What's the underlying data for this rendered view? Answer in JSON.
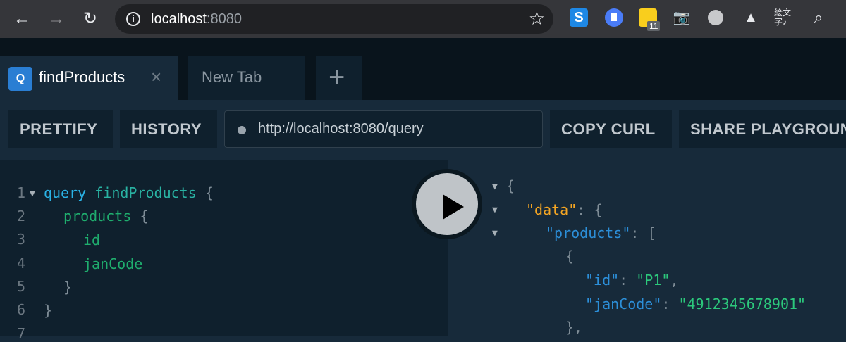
{
  "browser": {
    "url_host": "localhost",
    "url_port": ":8080",
    "extensions": [
      {
        "name": "s-extension-icon",
        "label": "S"
      },
      {
        "name": "bookmark-extension-icon"
      },
      {
        "name": "yellow-extension-icon",
        "badge": "11"
      },
      {
        "name": "camera-extension-icon"
      },
      {
        "name": "circle-extension-icon"
      },
      {
        "name": "warning-extension-icon"
      },
      {
        "name": "kanji-extension-icon",
        "label": "絵文字♪"
      },
      {
        "name": "search-extension-icon"
      }
    ]
  },
  "tabs": [
    {
      "badge": "Q",
      "title": "findProducts",
      "active": true
    },
    {
      "title": "New Tab",
      "active": false
    }
  ],
  "toolbar": {
    "prettify": "PRETTIFY",
    "history": "HISTORY",
    "endpoint": "http://localhost:8080/query",
    "copy_curl": "COPY CURL",
    "share": "SHARE PLAYGROUND"
  },
  "editor": {
    "line_numbers": [
      "1",
      "2",
      "3",
      "4",
      "5",
      "6",
      "7"
    ],
    "query_keyword": "query",
    "operation_name": "findProducts",
    "fields": {
      "products": "products",
      "id": "id",
      "janCode": "janCode"
    }
  },
  "result": {
    "data_key": "\"data\"",
    "products_key": "\"products\"",
    "id_key": "\"id\"",
    "id_value": "\"P1\"",
    "jancode_key": "\"janCode\"",
    "jancode_value": "\"4912345678901\""
  },
  "colors": {
    "accent_blue": "#2a7ed3",
    "keyword": "#2ab3e6",
    "field": "#1fae6e",
    "data_key": "#f5a623",
    "string": "#2cc97c"
  }
}
